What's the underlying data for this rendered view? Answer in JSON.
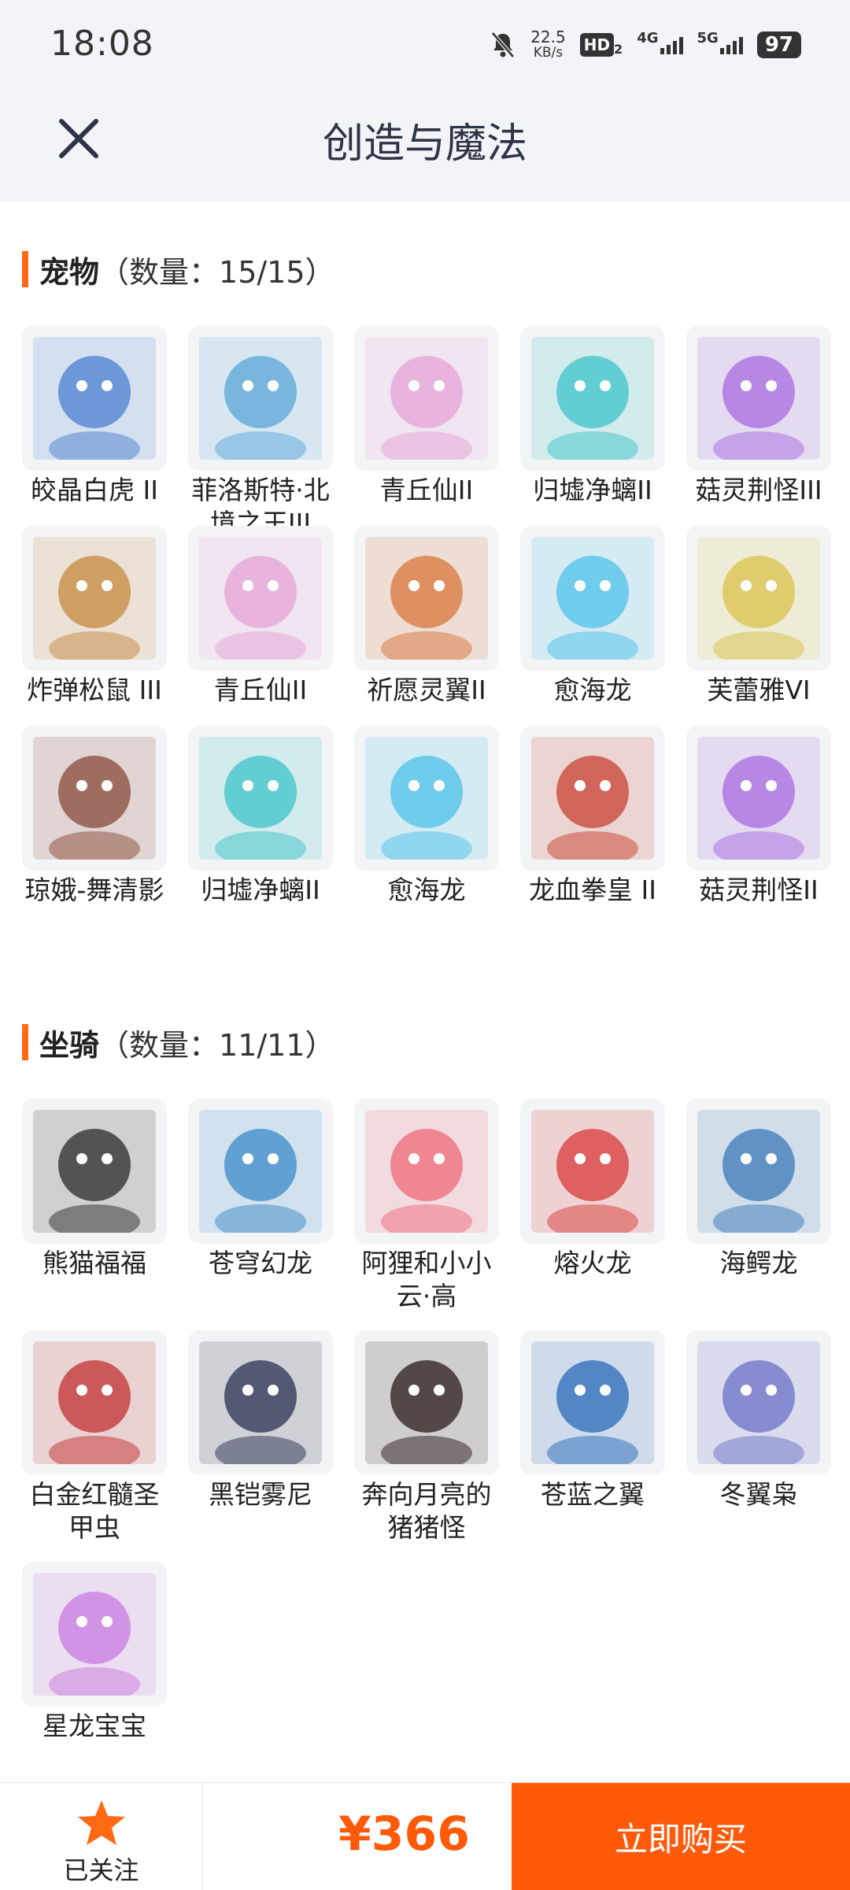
{
  "status_bar": {
    "time": "18:08",
    "speed_value": "22.5",
    "speed_unit": "KB/s",
    "hd": "HD",
    "net1": "4G",
    "net2": "5G",
    "battery": "97"
  },
  "header": {
    "title": "创造与魔法",
    "close_icon": "close-icon"
  },
  "pets": {
    "title": "宠物",
    "count": "（数量：15/15）",
    "items": [
      {
        "label": "皎晶白虎 II",
        "icon": "white-tiger-icon",
        "color": "#4a7fd0"
      },
      {
        "label": "菲洛斯特·北境之王III",
        "icon": "ice-king-icon",
        "color": "#5aa5d8"
      },
      {
        "label": "青丘仙II",
        "icon": "fox-fairy-icon",
        "color": "#e6a3d8"
      },
      {
        "label": "归墟净螭II",
        "icon": "water-dragon-icon",
        "color": "#3cc4c9"
      },
      {
        "label": "菇灵荆怪III",
        "icon": "mushroom-elf-icon",
        "color": "#a56be0"
      },
      {
        "label": "炸弹松鼠 III",
        "icon": "bomb-squirrel-icon",
        "color": "#c6883f"
      },
      {
        "label": "青丘仙II",
        "icon": "fox-fairy-icon",
        "color": "#e6a3d8"
      },
      {
        "label": "祈愿灵翼II",
        "icon": "wish-bird-icon",
        "color": "#d8763a"
      },
      {
        "label": "愈海龙",
        "icon": "sea-dragon-icon",
        "color": "#4cc2ea"
      },
      {
        "label": "芙蕾雅VI",
        "icon": "freya-icon",
        "color": "#d8c24a"
      },
      {
        "label": "琼娥-舞清影",
        "icon": "dancer-icon",
        "color": "#8a4a3a"
      },
      {
        "label": "归墟净螭II",
        "icon": "water-dragon-icon",
        "color": "#3cc4c9"
      },
      {
        "label": "愈海龙",
        "icon": "sea-dragon-icon",
        "color": "#4cc2ea"
      },
      {
        "label": "龙血拳皇 II",
        "icon": "dragon-fist-icon",
        "color": "#c94030"
      },
      {
        "label": "菇灵荆怪II",
        "icon": "mushroom-elf-icon",
        "color": "#a56be0"
      }
    ]
  },
  "mounts": {
    "title": "坐骑",
    "count": "（数量：11/11）",
    "items": [
      {
        "label": "熊猫福福",
        "icon": "panda-icon",
        "color": "#2a2a2a"
      },
      {
        "label": "苍穹幻龙",
        "icon": "sky-dragon-icon",
        "color": "#3a8ac8"
      },
      {
        "label": "阿狸和小小云·高",
        "icon": "ali-cloud-icon",
        "color": "#f06a7a"
      },
      {
        "label": "熔火龙",
        "icon": "lava-dragon-icon",
        "color": "#d83a3a"
      },
      {
        "label": "海鳄龙",
        "icon": "sea-croc-dragon-icon",
        "color": "#3a78b8"
      },
      {
        "label": "白金红髓圣甲虫",
        "icon": "beetle-icon",
        "color": "#c03030"
      },
      {
        "label": "黑铠雾尼",
        "icon": "black-armor-dragon-icon",
        "color": "#2a3050"
      },
      {
        "label": "奔向月亮的猪猪怪",
        "icon": "pig-icon",
        "color": "#2a1a1a"
      },
      {
        "label": "苍蓝之翼",
        "icon": "blue-wing-icon",
        "color": "#2a6ab8"
      },
      {
        "label": "冬翼枭",
        "icon": "owl-icon",
        "color": "#6a70c8"
      },
      {
        "label": "星龙宝宝",
        "icon": "star-dragon-baby-icon",
        "color": "#c87ae0"
      }
    ]
  },
  "footer": {
    "follow_label": "已关注",
    "follow_icon": "star-icon",
    "price": "¥366",
    "buy_label": "立即购买",
    "accent": "#ff5a0a"
  }
}
